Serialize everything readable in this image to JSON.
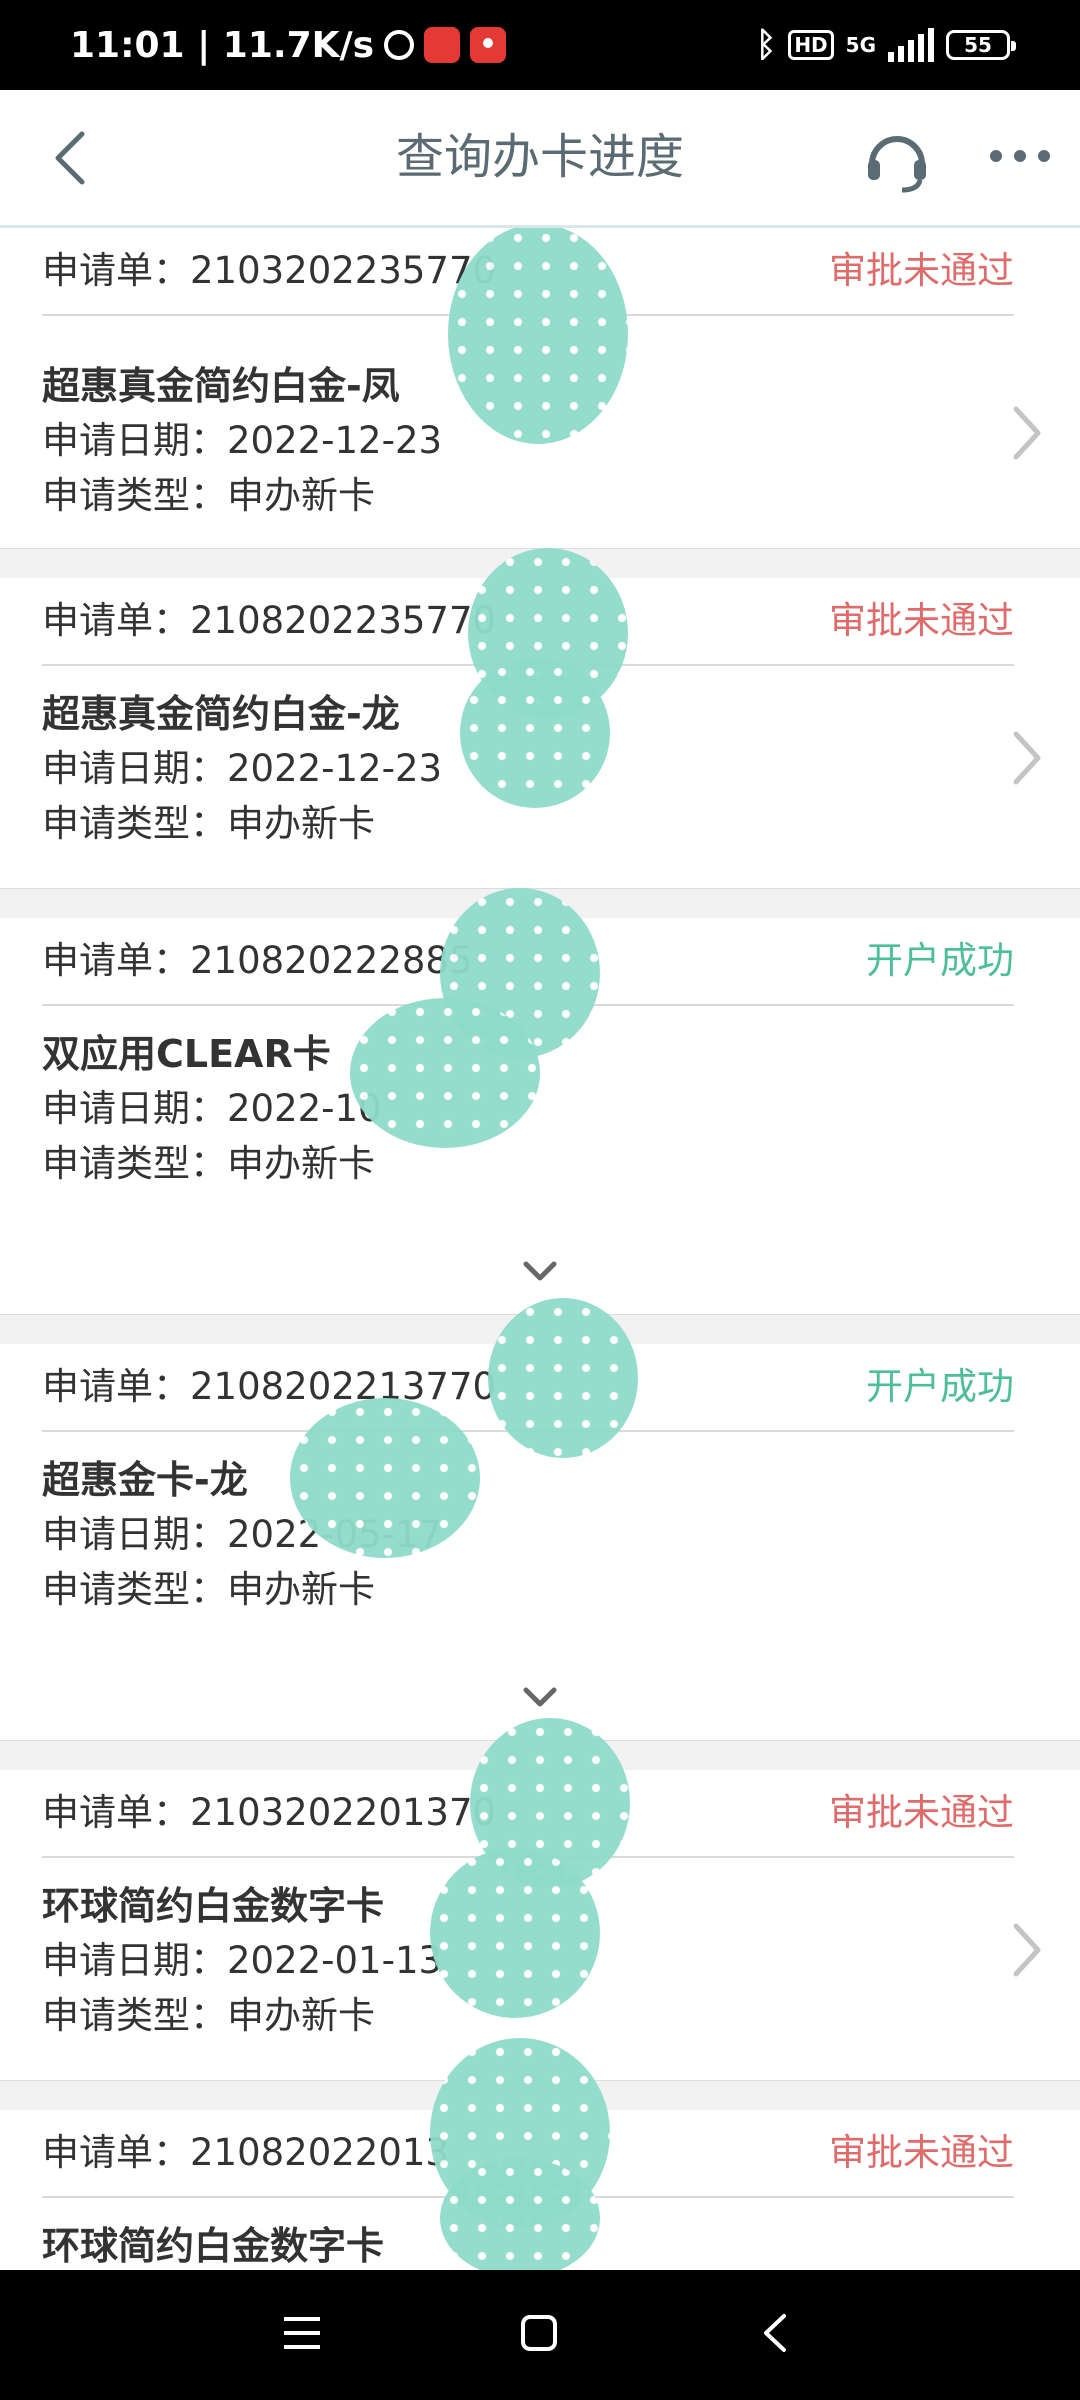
{
  "status_bar": {
    "time_speed": "11:01 | 11.7K/s",
    "hd": "HD",
    "network": "5G",
    "battery": "55"
  },
  "header": {
    "title": "查询办卡进度"
  },
  "applications": [
    {
      "number_label": "申请单：2103202235770",
      "status": "审批未通过",
      "status_kind": "fail",
      "card_name": "超惠真金简约白金-凤",
      "date_label": "申请日期：2022-12-23",
      "type_label": "申请类型：申办新卡"
    },
    {
      "number_label": "申请单：2108202235770",
      "status": "审批未通过",
      "status_kind": "fail",
      "card_name": "超惠真金简约白金-龙",
      "date_label": "申请日期：2022-12-23",
      "type_label": "申请类型：申办新卡"
    },
    {
      "number_label": "申请单：210820222885",
      "status": "开户成功",
      "status_kind": "success",
      "card_name": "双应用CLEAR卡",
      "date_label": "申请日期：2022-10",
      "type_label": "申请类型：申办新卡"
    },
    {
      "number_label": "申请单：2108202213770",
      "status": "开户成功",
      "status_kind": "success",
      "card_name": "超惠金卡-龙",
      "date_label": "申请日期：2022-05-17",
      "type_label": "申请类型：申办新卡"
    },
    {
      "number_label": "申请单：2103202201370",
      "status": "审批未通过",
      "status_kind": "fail",
      "card_name": "环球简约白金数字卡",
      "date_label": "申请日期：2022-01-13",
      "type_label": "申请类型：申办新卡"
    },
    {
      "number_label": "申请单：21082022013",
      "status": "审批未通过",
      "status_kind": "fail",
      "card_name": "环球简约白金数字卡",
      "date_label": "",
      "type_label": ""
    }
  ],
  "colors": {
    "status_fail": "#e06b6b",
    "status_success": "#4cbf9a",
    "title": "#5b6b73",
    "redaction_blob": "#8fdbc9"
  },
  "icons": {
    "back": "back-arrow-icon",
    "support": "headset-icon",
    "more": "more-dots-icon",
    "detail": "chevron-right-icon",
    "expand": "chevron-down-icon"
  }
}
